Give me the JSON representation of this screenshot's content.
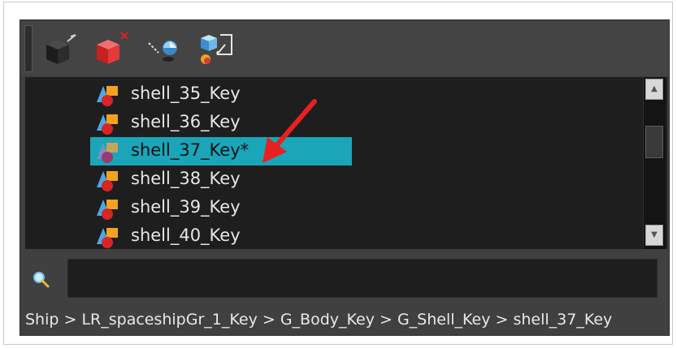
{
  "toolbar": {
    "buttons": [
      {
        "name": "add-peg-button",
        "icon": "black-cube-peg-icon"
      },
      {
        "name": "delete-peg-button",
        "icon": "red-cube-delete-icon"
      },
      {
        "name": "parent-button",
        "icon": "link-node-icon"
      },
      {
        "name": "transfer-button",
        "icon": "cube-transfer-icon"
      }
    ]
  },
  "tree": {
    "items": [
      {
        "label": "shell_35_Key",
        "selected": false
      },
      {
        "label": "shell_36_Key",
        "selected": false
      },
      {
        "label": "shell_37_Key*",
        "selected": true
      },
      {
        "label": "shell_38_Key",
        "selected": false
      },
      {
        "label": "shell_39_Key",
        "selected": false
      },
      {
        "label": "shell_40_Key",
        "selected": false
      }
    ]
  },
  "search": {
    "value": "",
    "placeholder": ""
  },
  "breadcrumb": {
    "text": "Ship > LR_spaceshipGr_1_Key > G_Body_Key > G_Shell_Key > shell_37_Key"
  },
  "colors": {
    "selection": "#1aa5b8",
    "panel_bg": "#404040",
    "tree_bg": "#1e1e1e",
    "annotation_arrow": "#e8201f"
  }
}
